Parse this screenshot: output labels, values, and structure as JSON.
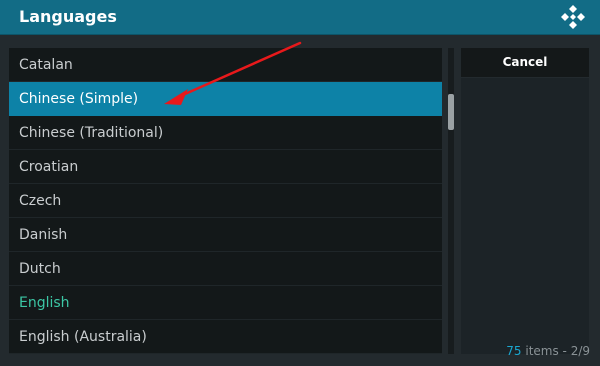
{
  "window": {
    "title": "Languages"
  },
  "list": {
    "items": [
      {
        "label": "Catalan",
        "state": "normal"
      },
      {
        "label": "Chinese (Simple)",
        "state": "selected"
      },
      {
        "label": "Chinese (Traditional)",
        "state": "normal"
      },
      {
        "label": "Croatian",
        "state": "normal"
      },
      {
        "label": "Czech",
        "state": "normal"
      },
      {
        "label": "Danish",
        "state": "normal"
      },
      {
        "label": "Dutch",
        "state": "normal"
      },
      {
        "label": "English",
        "state": "current"
      },
      {
        "label": "English (Australia)",
        "state": "normal"
      }
    ]
  },
  "buttons": {
    "cancel": "Cancel"
  },
  "footer": {
    "item_count": "75",
    "items_word": " items - ",
    "page": "2/9"
  },
  "colors": {
    "titlebar": "#126c86",
    "selected_row": "#0d82a7",
    "current_item_text": "#3cc7a5",
    "count_accent": "#1aa6cf",
    "annotation_arrow": "#e8191b"
  },
  "icons": {
    "logo": "kodi-logo-icon",
    "annotation": "red-arrow-annotation"
  }
}
